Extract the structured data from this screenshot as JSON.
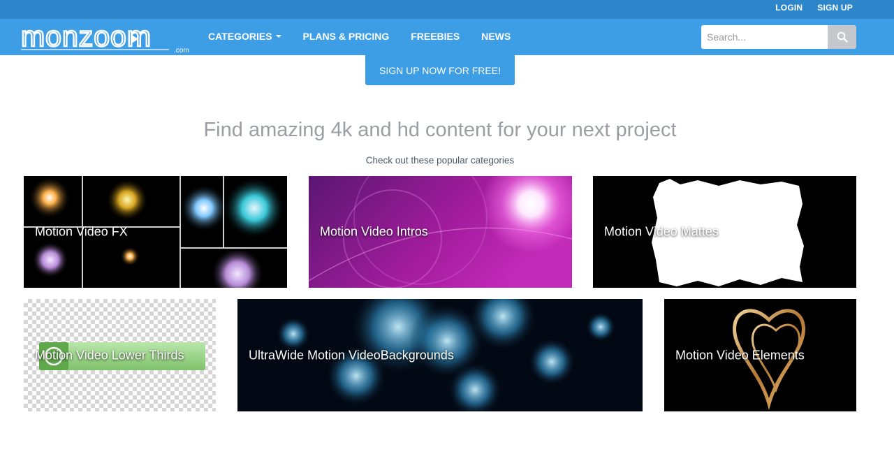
{
  "topbar": {
    "login": "LOGIN",
    "signup": "SIGN UP"
  },
  "brand": {
    "logo_text": "monzoom",
    "logo_domain": ".com"
  },
  "nav": {
    "categories": "CATEGORIES",
    "plans": "PLANS & PRICING",
    "freebies": "FREEBIES",
    "news": "NEWS"
  },
  "search": {
    "placeholder": "Search...",
    "icon": "search-icon"
  },
  "cta": {
    "label": "SIGN UP NOW FOR FREE!"
  },
  "hero": {
    "headline": "Find amazing 4k and hd content for your next project",
    "subhead": "Check out these popular categories"
  },
  "categories": [
    {
      "label": "Motion Video FX"
    },
    {
      "label": "Motion Video Intros"
    },
    {
      "label": "Motion Video Mattes"
    },
    {
      "label": "Motion Video Lower Thirds"
    },
    {
      "label": "UltraWide Motion VideoBackgrounds"
    },
    {
      "label": "Motion Video Elements"
    }
  ],
  "colors": {
    "topbar": "#2c86c9",
    "navbar": "#3d9ee6",
    "cta": "#3d9ee6",
    "headline": "#9a9ea3"
  }
}
